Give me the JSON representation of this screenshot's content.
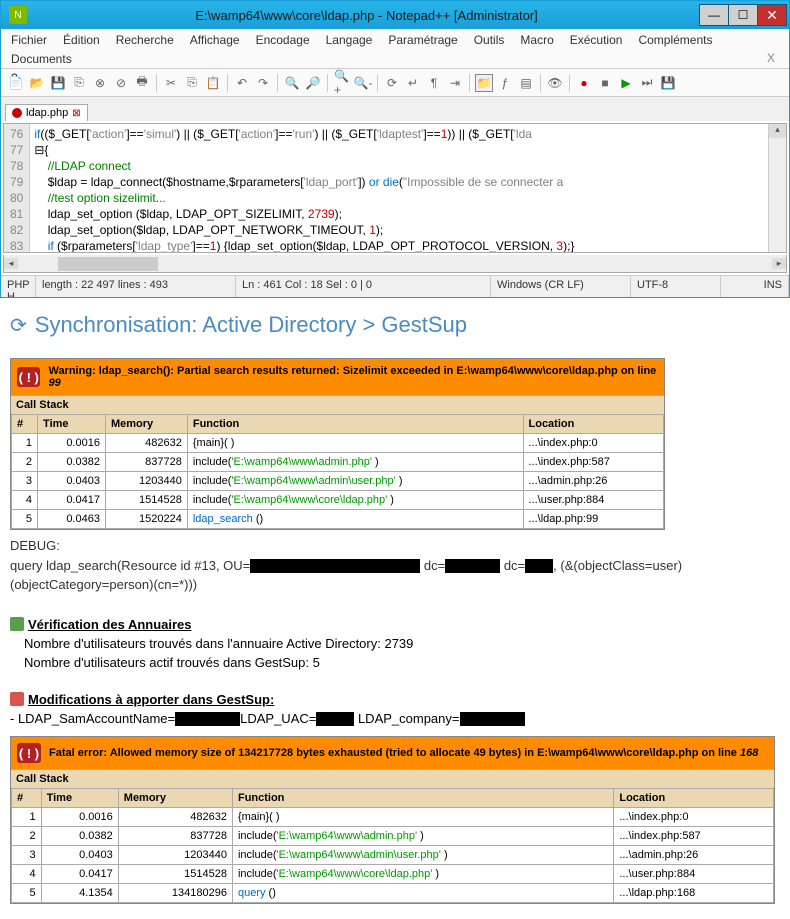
{
  "window": {
    "title": "E:\\wamp64\\www\\core\\ldap.php - Notepad++ [Administrator]"
  },
  "menu": [
    "Fichier",
    "Édition",
    "Recherche",
    "Affichage",
    "Encodage",
    "Langage",
    "Paramétrage",
    "Outils",
    "Macro",
    "Exécution",
    "Compléments",
    "Documents",
    "?"
  ],
  "tab": {
    "name": "ldap.php"
  },
  "code": {
    "lines": [
      "76",
      "77",
      "78",
      "79",
      "80",
      "81",
      "82",
      "83"
    ]
  },
  "status": {
    "lang": "PHP H",
    "len": "length : 22 497    lines : 493",
    "pos": "Ln : 461    Col : 18    Sel : 0 | 0",
    "eol": "Windows (CR LF)",
    "enc": "UTF-8",
    "ins": "INS"
  },
  "sync_title": "Synchronisation: Active Directory > GestSup",
  "warning": {
    "label": "Warning",
    "msg": ": ldap_search(): Partial search results returned: Sizelimit exceeded in E:\\wamp64\\www\\core\\ldap.php on line",
    "line": "99",
    "callstack": "Call Stack",
    "headers": [
      "#",
      "Time",
      "Memory",
      "Function",
      "Location"
    ],
    "rows": [
      {
        "n": "1",
        "t": "0.0016",
        "m": "482632",
        "fn": "{main}( )",
        "loc": "...\\index.php:0"
      },
      {
        "n": "2",
        "t": "0.0382",
        "m": "837728",
        "fn": "include(",
        "p": "'E:\\wamp64\\www\\admin.php'",
        "fe": " )",
        "loc": "...\\index.php:587"
      },
      {
        "n": "3",
        "t": "0.0403",
        "m": "1203440",
        "fn": "include(",
        "p": "'E:\\wamp64\\www\\admin\\user.php'",
        "fe": " )",
        "loc": "...\\admin.php:26"
      },
      {
        "n": "4",
        "t": "0.0417",
        "m": "1514528",
        "fn": "include(",
        "p": "'E:\\wamp64\\www\\core\\ldap.php'",
        "fe": " )",
        "loc": "...\\user.php:884"
      },
      {
        "n": "5",
        "t": "0.0463",
        "m": "1520224",
        "fnl": "ldap_search",
        "fe": " ()",
        "loc": "...\\ldap.php:99"
      }
    ]
  },
  "debug": {
    "h": "DEBUG:",
    "l1a": "query ldap_search(Resource id #13, OU=",
    "l1b": " dc=",
    "l1c": " dc=",
    "l1d": ", (&(objectClass=user)",
    "l2": "(objectCategory=person)(cn=*)))"
  },
  "verif": {
    "h": "Vérification des Annuaires",
    "p1": "Nombre d'utilisateurs trouvés dans l'annuaire Active Directory: 2739",
    "p2": "Nombre d'utilisateurs actif trouvés dans GestSup: 5"
  },
  "modif": {
    "h": "Modifications à apporter dans GestSup:",
    "l1a": "- LDAP_SamAccountName=",
    "l1b": "LDAP_UAC=",
    "l1c": " LDAP_company="
  },
  "fatal": {
    "label": "Fatal error",
    "msg": ": Allowed memory size of 134217728 bytes exhausted (tried to allocate 49 bytes) in E:\\wamp64\\www\\core\\ldap.php on line",
    "line": "168",
    "callstack": "Call Stack",
    "headers": [
      "#",
      "Time",
      "Memory",
      "Function",
      "Location"
    ],
    "rows": [
      {
        "n": "1",
        "t": "0.0016",
        "m": "482632",
        "fn": "{main}( )",
        "loc": "...\\index.php:0"
      },
      {
        "n": "2",
        "t": "0.0382",
        "m": "837728",
        "fn": "include(",
        "p": "'E:\\wamp64\\www\\admin.php'",
        "fe": " )",
        "loc": "...\\index.php:587"
      },
      {
        "n": "3",
        "t": "0.0403",
        "m": "1203440",
        "fn": "include(",
        "p": "'E:\\wamp64\\www\\admin\\user.php'",
        "fe": " )",
        "loc": "...\\admin.php:26"
      },
      {
        "n": "4",
        "t": "0.0417",
        "m": "1514528",
        "fn": "include(",
        "p": "'E:\\wamp64\\www\\core\\ldap.php'",
        "fe": " )",
        "loc": "...\\user.php:884"
      },
      {
        "n": "5",
        "t": "4.1354",
        "m": "134180296",
        "fnl": "query",
        "fe": " ()",
        "loc": "...\\ldap.php:168"
      }
    ]
  }
}
